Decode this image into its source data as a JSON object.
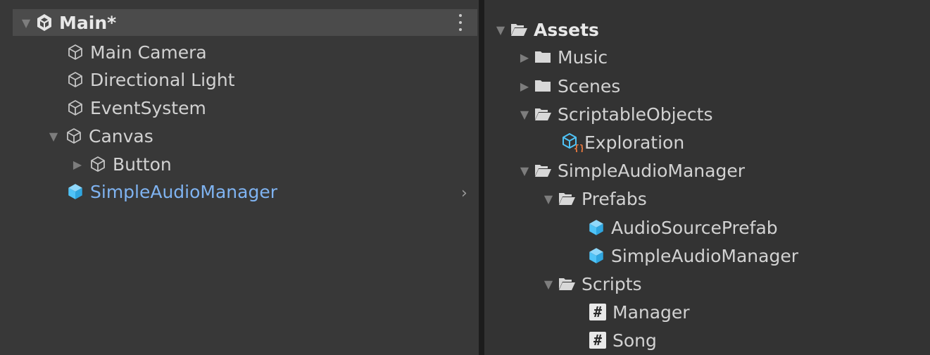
{
  "hierarchy": {
    "scene_name": "Main*",
    "items": [
      {
        "label": "Main Camera"
      },
      {
        "label": "Directional Light"
      },
      {
        "label": "EventSystem"
      },
      {
        "label": "Canvas"
      },
      {
        "label": "Button"
      },
      {
        "label": "SimpleAudioManager"
      }
    ],
    "selected_color": "#7fb3f1"
  },
  "project": {
    "items": [
      {
        "label": "Assets"
      },
      {
        "label": "Music"
      },
      {
        "label": "Scenes"
      },
      {
        "label": "ScriptableObjects"
      },
      {
        "label": "Exploration"
      },
      {
        "label": "SimpleAudioManager"
      },
      {
        "label": "Prefabs"
      },
      {
        "label": "AudioSourcePrefab"
      },
      {
        "label": "SimpleAudioManager"
      },
      {
        "label": "Scripts"
      },
      {
        "label": "Manager"
      },
      {
        "label": "Song"
      }
    ]
  },
  "colors": {
    "prefab_blue": "#4fc3f7",
    "scriptable_orange": "#f07b3f",
    "header_bg": "#4b4b4b"
  }
}
